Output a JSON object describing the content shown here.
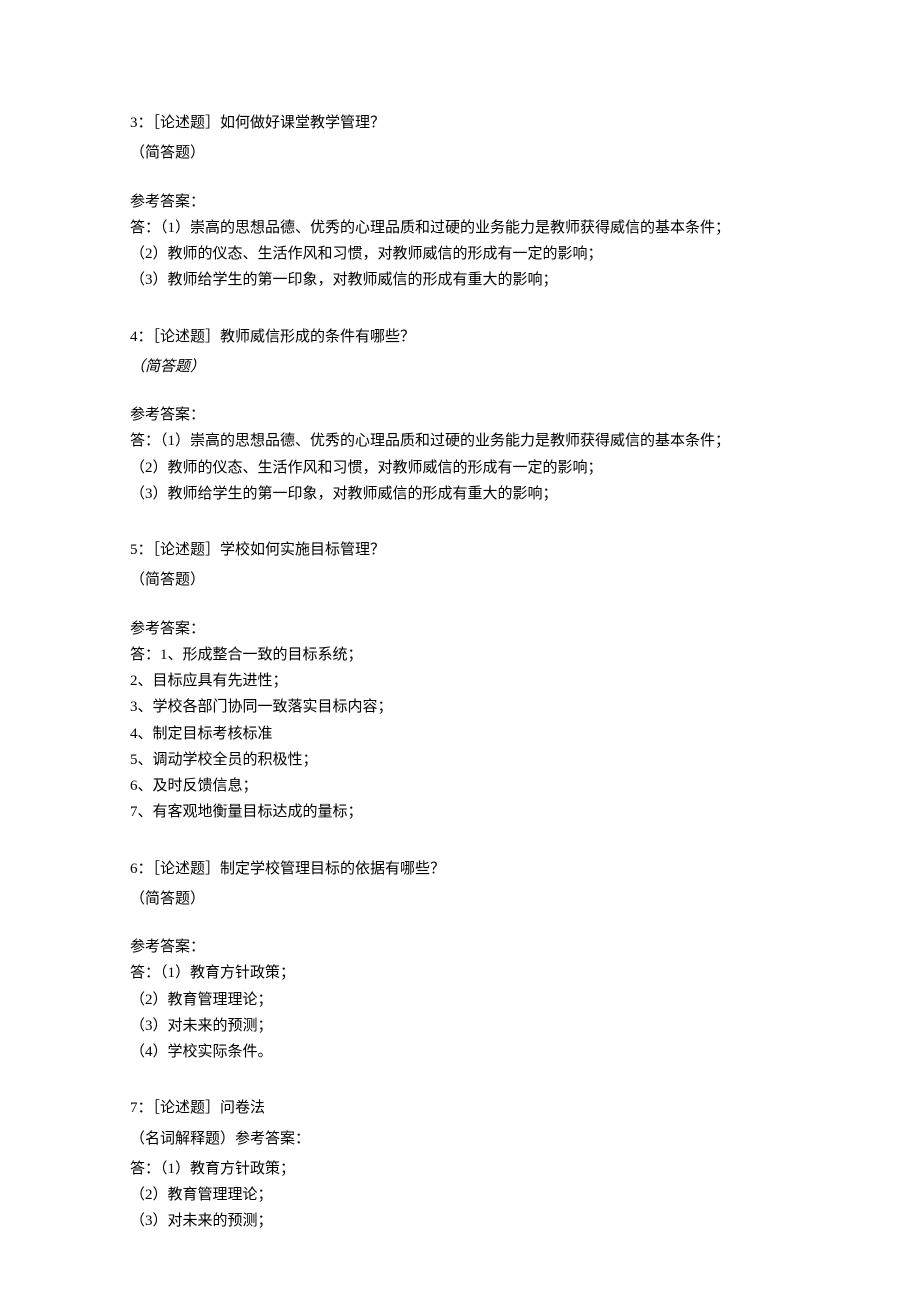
{
  "q3": {
    "title": "3：［论述题］如何做好课堂教学管理？",
    "type": "（简答题）",
    "ansLabel": "参考答案：",
    "lines": [
      "答：（1）崇高的思想品德、优秀的心理品质和过硬的业务能力是教师获得威信的基本条件；",
      "（2）教师的仪态、生活作风和习惯，对教师威信的形成有一定的影响；",
      "（3）教师给学生的第一印象，对教师威信的形成有重大的影响；"
    ]
  },
  "q4": {
    "title": "4：［论述题］教师威信形成的条件有哪些？",
    "type": "（简答题）",
    "ansLabel": "参考答案：",
    "lines": [
      "答：（1）崇高的思想品德、优秀的心理品质和过硬的业务能力是教师获得威信的基本条件；",
      "（2）教师的仪态、生活作风和习惯，对教师威信的形成有一定的影响；",
      "（3）教师给学生的第一印象，对教师威信的形成有重大的影响；"
    ]
  },
  "q5": {
    "title": "5：［论述题］学校如何实施目标管理？",
    "type": "（简答题）",
    "ansLabel": "参考答案：",
    "lines": [
      "答：1、形成整合一致的目标系统；",
      "2、目标应具有先进性；",
      "3、学校各部门协同一致落实目标内容；",
      "4、制定目标考核标准",
      "5、调动学校全员的积极性；",
      "6、及时反馈信息；",
      "7、有客观地衡量目标达成的量标；"
    ]
  },
  "q6": {
    "title": "6：［论述题］制定学校管理目标的依据有哪些？",
    "type": "（简答题）",
    "ansLabel": "参考答案：",
    "lines": [
      "答：（1）教育方针政策；",
      "（2）教育管理理论；",
      "（3）对未来的预测；",
      "（4）学校实际条件。"
    ]
  },
  "q7": {
    "title": "7：［论述题］问卷法",
    "type": "（名词解释题）参考答案：",
    "lines": [
      "答：（1）教育方针政策；",
      "（2）教育管理理论；",
      "（3）对未来的预测；"
    ]
  }
}
